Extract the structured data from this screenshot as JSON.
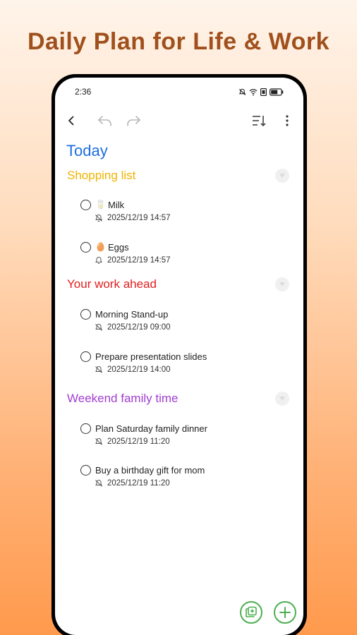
{
  "headline": "Daily Plan for Life & Work",
  "status": {
    "time": "2:36"
  },
  "page": {
    "title": "Today"
  },
  "colors": {
    "headline": "#a0501c",
    "title": "#1e6fe0",
    "shopping": "#f0b400",
    "work": "#e02020",
    "family": "#a040d0",
    "fab": "#4caf50"
  },
  "sections": [
    {
      "title": "Shopping list",
      "tasks": [
        {
          "emoji": "🥛",
          "text": "Milk",
          "date": "2025/12/19 14:57"
        },
        {
          "emoji": "🥚",
          "text": "Eggs",
          "date": "2025/12/19 14:57"
        }
      ]
    },
    {
      "title": "Your work ahead",
      "tasks": [
        {
          "text": "Morning Stand-up",
          "date": "2025/12/19 09:00"
        },
        {
          "text": "Prepare presentation slides",
          "date": "2025/12/19 14:00"
        }
      ]
    },
    {
      "title": "Weekend family time",
      "tasks": [
        {
          "text": "Plan Saturday family dinner",
          "date": "2025/12/19 11:20"
        },
        {
          "text": "Buy a birthday gift for mom",
          "date": "2025/12/19 11:20"
        }
      ]
    }
  ]
}
